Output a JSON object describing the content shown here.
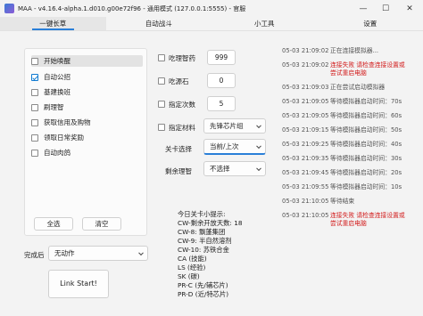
{
  "titlebar": {
    "title": "MAA - v4.16.4-alpha.1.d010.g00e72f96 - 通用模式 (127.0.0.1:5555) - 官服",
    "minimize": "—",
    "maximize": "☐",
    "close": "✕"
  },
  "tabs": [
    "一键长草",
    "自动战斗",
    "小工具",
    "设置"
  ],
  "tasks": [
    {
      "label": "开始唤醒",
      "checked": false
    },
    {
      "label": "自动公招",
      "checked": true
    },
    {
      "label": "基建换班",
      "checked": false
    },
    {
      "label": "刷理智",
      "checked": false
    },
    {
      "label": "获取信用及购物",
      "checked": false
    },
    {
      "label": "领取日常奖励",
      "checked": false
    },
    {
      "label": "自动肉鸽",
      "checked": false
    }
  ],
  "task_buttons": {
    "select_all": "全选",
    "clear": "清空"
  },
  "after_complete": {
    "label": "完成后",
    "value": "无动作"
  },
  "link_start": "Link Start!",
  "settings": {
    "use_medicine": {
      "label": "吃理智药",
      "value": "999"
    },
    "use_stone": {
      "label": "吃源石",
      "value": "0"
    },
    "times": {
      "label": "指定次数",
      "value": "5"
    },
    "material": {
      "label": "指定材料",
      "value": "先锋芯片组"
    },
    "stage": {
      "label": "关卡选择",
      "value": "当前/上次"
    },
    "remaining": {
      "label": "剩余理智",
      "value": "不选择"
    }
  },
  "tips": [
    "今日关卡小提示:",
    "CW-剩余开放天数: 18",
    "CW-8: 飘蓬集团",
    "CW-9: 半自然溶剂",
    "CW-10: 苏铁合金",
    "CA (技能)",
    "LS (经验)",
    "SK (碳)",
    "PR-C (先/辅芯片)",
    "PR-D (近/特芯片)"
  ],
  "log": [
    {
      "time": "05-03  21:09:02",
      "msg": "正在连接模拟器...",
      "error": false
    },
    {
      "time": "05-03  21:09:02",
      "msg": "连接失败 请检查连接设置或尝试重启电脑",
      "error": true
    },
    {
      "time": "05-03  21:09:03",
      "msg": "正在尝试启动模拟器",
      "error": false
    },
    {
      "time": "05-03  21:09:05",
      "msg": "等待模拟器启动时间：70s",
      "error": false
    },
    {
      "time": "05-03  21:09:05",
      "msg": "等待模拟器启动时间：60s",
      "error": false
    },
    {
      "time": "05-03  21:09:15",
      "msg": "等待模拟器启动时间：50s",
      "error": false
    },
    {
      "time": "05-03  21:09:25",
      "msg": "等待模拟器启动时间：40s",
      "error": false
    },
    {
      "time": "05-03  21:09:35",
      "msg": "等待模拟器启动时间：30s",
      "error": false
    },
    {
      "time": "05-03  21:09:45",
      "msg": "等待模拟器启动时间：20s",
      "error": false
    },
    {
      "time": "05-03  21:09:55",
      "msg": "等待模拟器启动时间：10s",
      "error": false
    },
    {
      "time": "05-03  21:10:05",
      "msg": "等待结束",
      "error": false
    },
    {
      "time": "05-03  21:10:05",
      "msg": "连接失败 请检查连接设置或尝试重启电脑",
      "error": true
    }
  ]
}
